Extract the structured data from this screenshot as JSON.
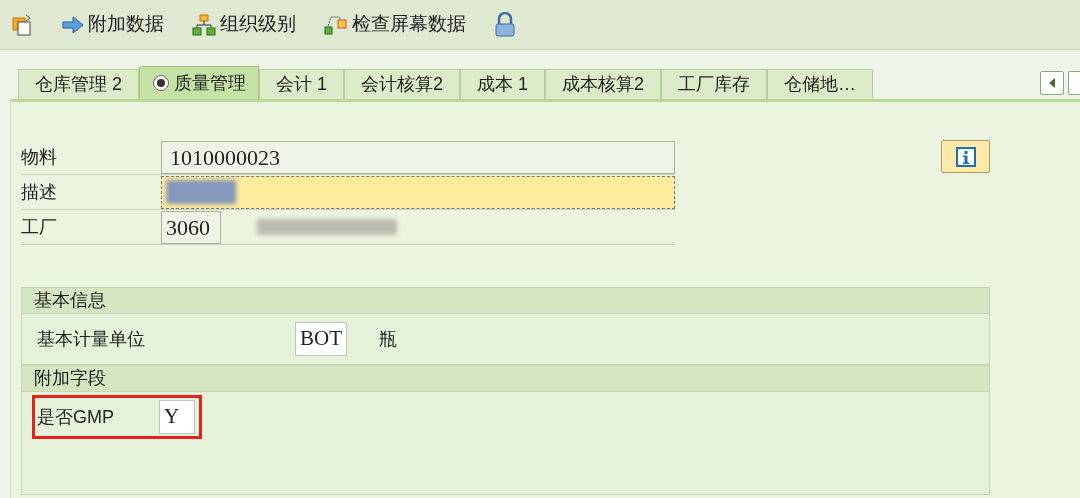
{
  "toolbar": [
    {
      "kind": "new-doc"
    },
    {
      "kind": "arrow",
      "label": "附加数据"
    },
    {
      "kind": "org",
      "label": "组织级别"
    },
    {
      "kind": "check",
      "label": "检查屏幕数据"
    },
    {
      "kind": "lock"
    }
  ],
  "tabs": [
    {
      "label": "仓库管理 2",
      "selected": false
    },
    {
      "label": "质量管理",
      "selected": true
    },
    {
      "label": "会计 1",
      "selected": false
    },
    {
      "label": "会计核算2",
      "selected": false
    },
    {
      "label": "成本 1",
      "selected": false
    },
    {
      "label": "成本核算2",
      "selected": false
    },
    {
      "label": "工厂库存",
      "selected": false
    },
    {
      "label": "仓储地…",
      "selected": false
    }
  ],
  "header_fields": [
    {
      "label": "物料",
      "value": "1010000023",
      "kind": "wide"
    },
    {
      "label": "描述",
      "kind": "focused"
    },
    {
      "label": "工厂",
      "value": "3060",
      "kind": "short"
    }
  ],
  "groups": [
    {
      "title": "基本信息",
      "fields": [
        {
          "label": "基本计量单位",
          "value": "BOT",
          "text": "瓶",
          "highlighted": false
        }
      ]
    },
    {
      "title": "附加字段",
      "fields": [
        {
          "label": "是否GMP",
          "value": "Y",
          "highlighted": true
        }
      ]
    }
  ]
}
